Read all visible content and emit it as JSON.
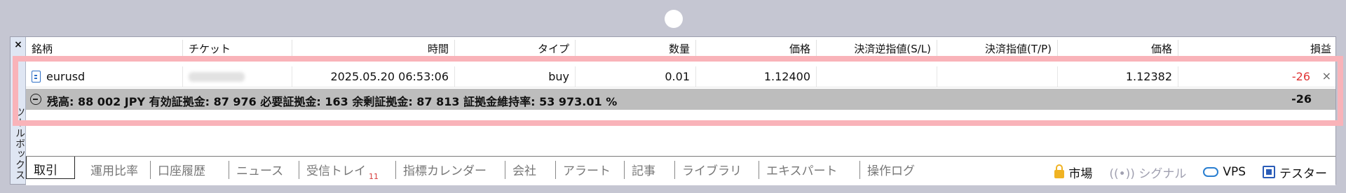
{
  "toolbox": {
    "close_glyph": "×",
    "title": "ツールボックス"
  },
  "table": {
    "columns": [
      "銘柄",
      "チケット",
      "時間",
      "タイプ",
      "数量",
      "価格",
      "決済逆指値(S/L)",
      "決済指値(T/P)",
      "価格",
      "損益"
    ],
    "rows": [
      {
        "symbol": "eurusd",
        "time": "2025.05.20 06:53:06",
        "type": "buy",
        "volume": "0.01",
        "open_price": "1.12400",
        "sl": "",
        "tp": "",
        "current_price": "1.12382",
        "profit": "-26",
        "close_glyph": "×"
      }
    ],
    "summary": {
      "text": "残高: 88 002 JPY  有効証拠金: 87 976  必要証拠金: 163  余剰証拠金: 87 813  証拠金維持率: 53 973.01 %",
      "total": "-26"
    }
  },
  "tabs": {
    "items": [
      {
        "label": "取引",
        "badge": ""
      },
      {
        "label": "運用比率",
        "badge": ""
      },
      {
        "label": "口座履歴",
        "badge": ""
      },
      {
        "label": "ニュース",
        "badge": ""
      },
      {
        "label": "受信トレイ",
        "badge": "11"
      },
      {
        "label": "指標カレンダー",
        "badge": ""
      },
      {
        "label": "会社",
        "badge": ""
      },
      {
        "label": "アラート",
        "badge": ""
      },
      {
        "label": "記事",
        "badge": ""
      },
      {
        "label": "ライブラリ",
        "badge": ""
      },
      {
        "label": "エキスパート",
        "badge": ""
      },
      {
        "label": "操作ログ",
        "badge": ""
      }
    ],
    "right": {
      "market": "市場",
      "signal": "((•)) シグナル",
      "vps": "VPS",
      "tester": "テスター"
    }
  },
  "colors": {
    "highlight": "#f9b3b9",
    "negative": "#e03535",
    "summary_bg": "#bdbdbd",
    "accent": "#2a7fd1"
  }
}
